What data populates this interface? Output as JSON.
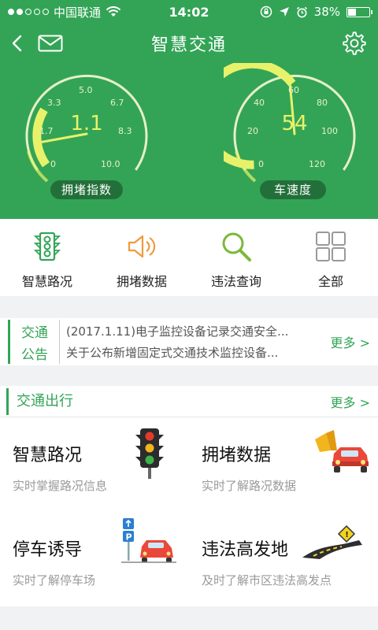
{
  "status": {
    "carrier": "中国联通",
    "time": "14:02",
    "battery": "38%",
    "battery_level": 0.38
  },
  "nav": {
    "title": "智慧交通"
  },
  "gauges": {
    "congestion": {
      "label": "拥堵指数",
      "value": "1.1",
      "ticks": [
        "0",
        "1.7",
        "3.3",
        "5.0",
        "6.7",
        "8.3",
        "10.0"
      ]
    },
    "speed": {
      "label": "车速度",
      "value": "54",
      "ticks": [
        "0",
        "20",
        "40",
        "60",
        "80",
        "100",
        "120"
      ]
    }
  },
  "menu": [
    {
      "label": "智慧路况",
      "icon": "traffic-light-icon"
    },
    {
      "label": "拥堵数据",
      "icon": "speaker-icon"
    },
    {
      "label": "违法查询",
      "icon": "search-icon"
    },
    {
      "label": "全部",
      "icon": "grid-icon"
    }
  ],
  "notice": {
    "tag_top": "交通",
    "tag_bottom": "公告",
    "line1": "(2017.1.11)电子监控设备记录交通安全...",
    "line2": "关于公布新增固定式交通技术监控设备...",
    "more": "更多 >"
  },
  "travel": {
    "title": "交通出行",
    "more": "更多 >",
    "cards": [
      {
        "title": "智慧路况",
        "sub": "实时掌握路况信息",
        "icon": "traffic-light-icon"
      },
      {
        "title": "拥堵数据",
        "sub": "实时了解路况数据",
        "icon": "car-speaker-icon"
      },
      {
        "title": "停车诱导",
        "sub": "实时了解停车场",
        "icon": "parking-icon"
      },
      {
        "title": "违法高发地",
        "sub": "及时了解市区违法高发点",
        "icon": "warning-road-icon"
      }
    ]
  },
  "colors": {
    "primary": "#33a456",
    "accent": "#e7f26a"
  }
}
